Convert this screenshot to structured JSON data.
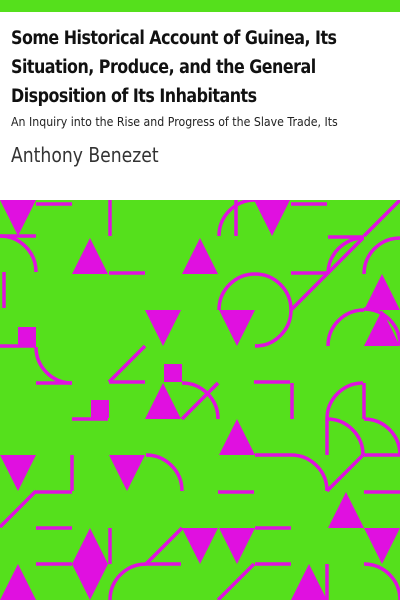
{
  "cover": {
    "title_lines": [
      "Some Historical Account of Guinea, Its",
      "Situation, Produce, and the General",
      "Disposition of Its Inhabitants"
    ],
    "subtitle": "An Inquiry into the Rise and Progress of the Slave Trade, Its",
    "author": "Anthony Benezet"
  },
  "colors": {
    "top_bar": "#55e01c",
    "pattern_background": "#55e01c",
    "pattern_shapes": "#e010e0"
  }
}
